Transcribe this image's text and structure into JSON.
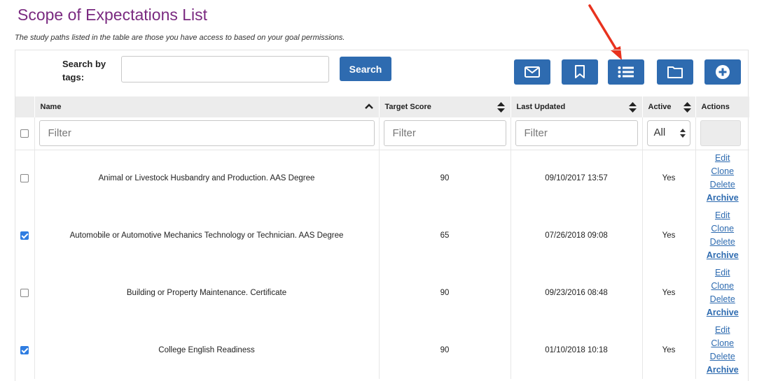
{
  "page": {
    "title": "Scope of Expectations List",
    "subtitle": "The study paths listed in the table are those you have access to based on your goal permissions."
  },
  "search": {
    "label": "Search by tags:",
    "value": "",
    "button_label": "Search"
  },
  "toolbar": {
    "buttons": [
      {
        "icon": "envelope-icon"
      },
      {
        "icon": "bookmark-icon"
      },
      {
        "icon": "list-icon"
      },
      {
        "icon": "folder-icon"
      },
      {
        "icon": "plus-circle-icon"
      }
    ]
  },
  "table": {
    "columns": [
      "Name",
      "Target Score",
      "Last Updated",
      "Active",
      "Actions"
    ],
    "filters": {
      "name_placeholder": "Filter",
      "target_placeholder": "Filter",
      "updated_placeholder": "Filter",
      "active_selected": "All"
    },
    "rows": [
      {
        "checked": false,
        "name": "Animal or Livestock Husbandry and Production. AAS Degree",
        "target_score": "90",
        "last_updated": "09/10/2017 13:57",
        "active": "Yes"
      },
      {
        "checked": true,
        "name": "Automobile or Automotive Mechanics Technology or Technician. AAS Degree",
        "target_score": "65",
        "last_updated": "07/26/2018 09:08",
        "active": "Yes"
      },
      {
        "checked": false,
        "name": "Building or Property Maintenance. Certificate",
        "target_score": "90",
        "last_updated": "09/23/2016 08:48",
        "active": "Yes"
      },
      {
        "checked": true,
        "name": "College English Readiness",
        "target_score": "90",
        "last_updated": "01/10/2018 10:18",
        "active": "Yes"
      }
    ],
    "actions": [
      "Edit",
      "Clone",
      "Delete",
      "Archive"
    ]
  },
  "colors": {
    "title": "#7a2a80",
    "button": "#2e6bb0",
    "annotation_arrow": "#e8321e"
  }
}
